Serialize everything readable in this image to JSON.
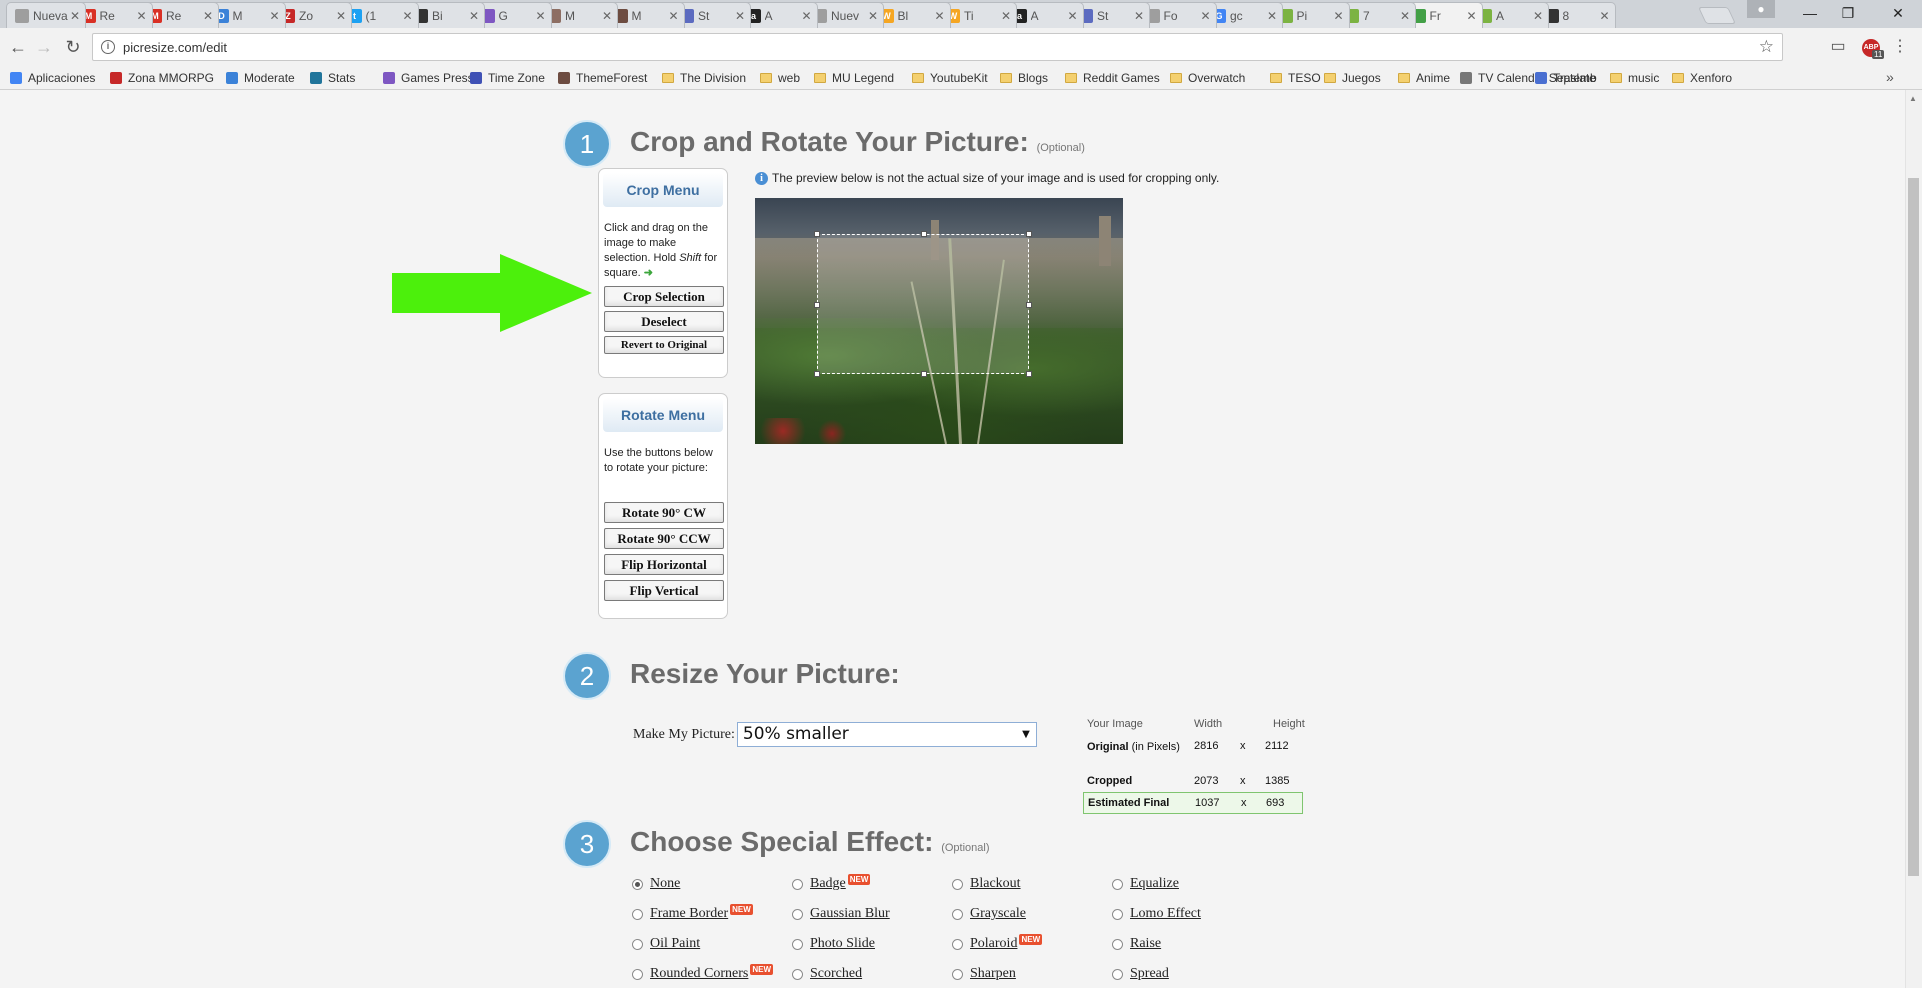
{
  "browser": {
    "tabs": [
      {
        "title": "Nueva",
        "color": "#9e9e9e",
        "icon": "blank-icon",
        "glyph": ""
      },
      {
        "title": "Re",
        "color": "#d93025",
        "icon": "gmail-icon",
        "glyph": "M"
      },
      {
        "title": "Re",
        "color": "#d93025",
        "icon": "gmail-icon",
        "glyph": "M"
      },
      {
        "title": "M",
        "color": "#3b82d8",
        "icon": "d-icon",
        "glyph": "D"
      },
      {
        "title": "Zo",
        "color": "#c62828",
        "icon": "z-icon",
        "glyph": "Z"
      },
      {
        "title": "(1",
        "color": "#1da1f2",
        "icon": "twitter-icon",
        "glyph": "t"
      },
      {
        "title": "Bi",
        "color": "#333333",
        "icon": "app-icon",
        "glyph": ""
      },
      {
        "title": "G",
        "color": "#7e57c2",
        "icon": "app-icon",
        "glyph": ""
      },
      {
        "title": "M",
        "color": "#8d6e63",
        "icon": "app-icon",
        "glyph": ""
      },
      {
        "title": "M",
        "color": "#6d4c41",
        "icon": "gear-icon",
        "glyph": ""
      },
      {
        "title": "St",
        "color": "#5c6bc0",
        "icon": "app-icon",
        "glyph": ""
      },
      {
        "title": "A",
        "color": "#222222",
        "icon": "amazon-icon",
        "glyph": "a"
      },
      {
        "title": "Nuev",
        "color": "#9e9e9e",
        "icon": "blank-icon",
        "glyph": ""
      },
      {
        "title": "Bl",
        "color": "#f5a623",
        "icon": "app-icon",
        "glyph": "W"
      },
      {
        "title": "Ti",
        "color": "#f5a623",
        "icon": "app-icon",
        "glyph": "W"
      },
      {
        "title": "A",
        "color": "#222222",
        "icon": "amazon-icon",
        "glyph": "a"
      },
      {
        "title": "St",
        "color": "#5c6bc0",
        "icon": "app-icon",
        "glyph": ""
      },
      {
        "title": "Fo",
        "color": "#9e9e9e",
        "icon": "page-icon",
        "glyph": ""
      },
      {
        "title": "gc",
        "color": "#4285f4",
        "icon": "google-icon",
        "glyph": "G"
      },
      {
        "title": "Pi",
        "color": "#7cb342",
        "icon": "app-icon",
        "glyph": ""
      },
      {
        "title": "7",
        "color": "#7cb342",
        "icon": "app-icon",
        "glyph": ""
      },
      {
        "title": "Fr",
        "color": "#43a047",
        "icon": "picresize-icon",
        "glyph": ""
      },
      {
        "title": "A",
        "color": "#7cb342",
        "icon": "app-icon",
        "glyph": ""
      },
      {
        "title": "8",
        "color": "#333333",
        "icon": "app-icon",
        "glyph": ""
      }
    ],
    "active_tab": 21,
    "url": "picresize.com/edit",
    "ext_count": "11",
    "bookmarks": [
      {
        "label": "Aplicaciones",
        "icon": "apps-grid-icon",
        "color": "#4285f4"
      },
      {
        "label": "Zona MMORPG",
        "icon": "z-icon",
        "color": "#c62828"
      },
      {
        "label": "Moderate",
        "icon": "d-icon",
        "color": "#3b82d8"
      },
      {
        "label": "Stats",
        "icon": "wordpress-icon",
        "color": "#21759b"
      },
      {
        "label": "Games Press",
        "icon": "app-icon",
        "color": "#7e57c2"
      },
      {
        "label": "Time Zone",
        "icon": "clock-icon",
        "color": "#3f51b5"
      },
      {
        "label": "ThemeForest",
        "icon": "app-icon",
        "color": "#6d4c41"
      },
      {
        "label": "The Division",
        "icon": "folder-icon",
        "color": ""
      },
      {
        "label": "web",
        "icon": "folder-icon",
        "color": ""
      },
      {
        "label": "MU Legend",
        "icon": "folder-icon",
        "color": ""
      },
      {
        "label": "YoutubeKit",
        "icon": "folder-icon",
        "color": ""
      },
      {
        "label": "Blogs",
        "icon": "folder-icon",
        "color": ""
      },
      {
        "label": "Reddit Games",
        "icon": "folder-icon",
        "color": ""
      },
      {
        "label": "Overwatch",
        "icon": "folder-icon",
        "color": ""
      },
      {
        "label": "TESO",
        "icon": "folder-icon",
        "color": ""
      },
      {
        "label": "Juegos",
        "icon": "folder-icon",
        "color": ""
      },
      {
        "label": "Anime",
        "icon": "folder-icon",
        "color": ""
      },
      {
        "label": "TV Calendar Septemb",
        "icon": "app-icon",
        "color": "#777777"
      },
      {
        "label": "Traslate",
        "icon": "translate-icon",
        "color": "#4a6fd1"
      },
      {
        "label": "music",
        "icon": "folder-icon",
        "color": ""
      },
      {
        "label": "Xenforo",
        "icon": "folder-icon",
        "color": ""
      }
    ]
  },
  "step1": {
    "number": "1",
    "title": "Crop and Rotate Your Picture:",
    "optional": "(Optional)",
    "crop_menu": {
      "title": "Crop Menu",
      "text_a": "Click and drag on the image to make selection. Hold ",
      "text_em": "Shift",
      "text_b": " for square.",
      "crop_btn": "Crop Selection",
      "deselect_btn": "Deselect",
      "revert_btn": "Revert to Original"
    },
    "rotate_menu": {
      "title": "Rotate Menu",
      "text": "Use the buttons below to rotate your picture:",
      "cw_btn": "Rotate 90° CW",
      "ccw_btn": "Rotate 90° CCW",
      "flip_h_btn": "Flip Horizontal",
      "flip_v_btn": "Flip Vertical"
    },
    "note": "The preview below is not the actual size of your image and is used for cropping only."
  },
  "step2": {
    "number": "2",
    "title": "Resize Your Picture:",
    "make_label": "Make My Picture:",
    "select_value": "50% smaller",
    "table": {
      "headers": [
        "Your Image",
        "Width",
        "",
        "Height"
      ],
      "rows": [
        {
          "label": "Original (in Pixels)",
          "label_bold": "Original",
          "label_rest": " (in Pixels)",
          "width": "2816",
          "x": "x",
          "height": "2112"
        },
        {
          "label_bold": "Cropped",
          "label_rest": "",
          "width": "2073",
          "x": "x",
          "height": "1385"
        },
        {
          "label_bold": "Estimated Final",
          "label_rest": "",
          "width": "1037",
          "x": "x",
          "height": "693"
        }
      ]
    }
  },
  "step3": {
    "number": "3",
    "title": "Choose Special Effect:",
    "optional": "(Optional)",
    "new_tag": "NEW",
    "effects": [
      {
        "label": "None",
        "checked": true,
        "new": false
      },
      {
        "label": "Badge",
        "checked": false,
        "new": true
      },
      {
        "label": "Blackout",
        "checked": false,
        "new": false
      },
      {
        "label": "Equalize",
        "checked": false,
        "new": false
      },
      {
        "label": "Frame Border",
        "checked": false,
        "new": true
      },
      {
        "label": "Gaussian Blur",
        "checked": false,
        "new": false
      },
      {
        "label": "Grayscale",
        "checked": false,
        "new": false
      },
      {
        "label": "Lomo Effect",
        "checked": false,
        "new": false
      },
      {
        "label": "Oil Paint",
        "checked": false,
        "new": false
      },
      {
        "label": "Photo Slide",
        "checked": false,
        "new": false
      },
      {
        "label": "Polaroid",
        "checked": false,
        "new": true
      },
      {
        "label": "Raise",
        "checked": false,
        "new": false
      },
      {
        "label": "Rounded Corners",
        "checked": false,
        "new": true
      },
      {
        "label": "Scorched",
        "checked": false,
        "new": false
      },
      {
        "label": "Sharpen",
        "checked": false,
        "new": false
      },
      {
        "label": "Spread",
        "checked": false,
        "new": false
      }
    ]
  },
  "colors": {
    "step_circle": "#5ba3d0",
    "menu_title": "#3e6fa1",
    "arrow": "#4cf00c",
    "new_tag": "#e8502f"
  }
}
